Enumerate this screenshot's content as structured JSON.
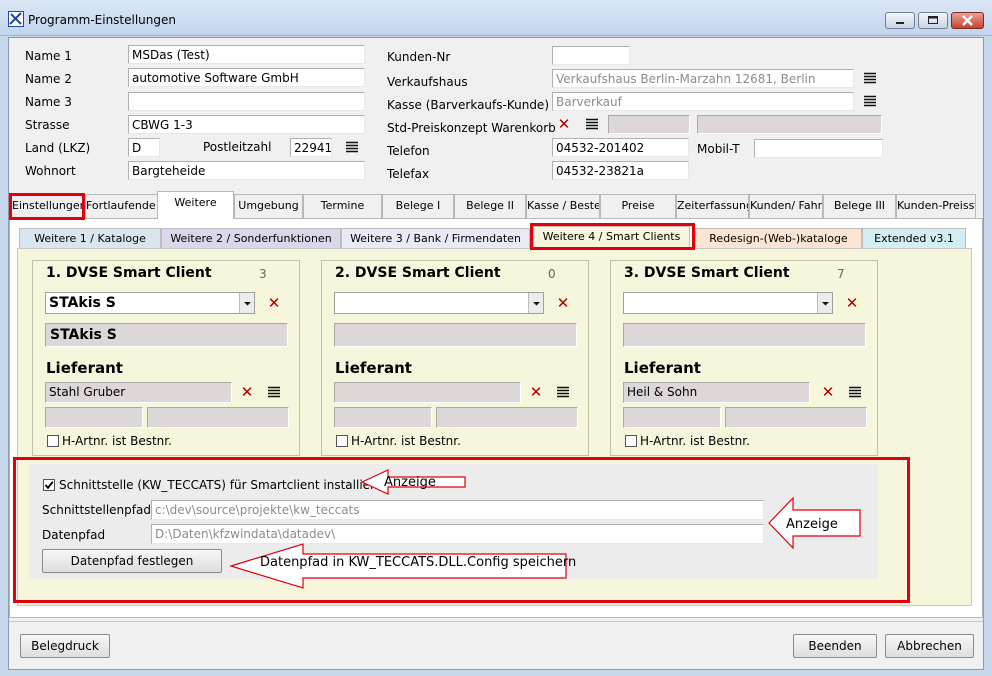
{
  "window": {
    "title": "Programm-Einstellungen"
  },
  "form": {
    "name1": {
      "label": "Name 1",
      "value": "MSDas (Test)"
    },
    "name2": {
      "label": "Name 2",
      "value": "automotive Software GmbH"
    },
    "name3": {
      "label": "Name 3",
      "value": ""
    },
    "strasse": {
      "label": "Strasse",
      "value": "CBWG 1-3"
    },
    "land": {
      "label": "Land (LKZ)",
      "value": "D"
    },
    "plz": {
      "label": "Postleitzahl",
      "value": "22941"
    },
    "wohnort": {
      "label": "Wohnort",
      "value": "Bargteheide"
    },
    "kundennr": {
      "label": "Kunden-Nr",
      "value": ""
    },
    "verkaufshaus": {
      "label": "Verkaufshaus",
      "value": "Verkaufshaus Berlin-Marzahn 12681, Berlin"
    },
    "kasse": {
      "label": "Kasse (Barverkaufs-Kunde)",
      "value": "Barverkauf"
    },
    "preiskonzept": {
      "label": "Std-Preiskonzept Warenkorb",
      "value": ""
    },
    "telefon": {
      "label": "Telefon",
      "value": "04532-201402"
    },
    "mobil": {
      "label": "Mobil-T",
      "value": ""
    },
    "telefax": {
      "label": "Telefax",
      "value": "04532-23821a"
    }
  },
  "tabs": [
    "Einstellungen",
    "Fortlaufende N",
    "Weitere",
    "Umgebung",
    "Termine",
    "Belege I",
    "Belege II",
    "Kasse / Beste",
    "Preise",
    "Zeiterfassung",
    "Kunden/ Fahrz",
    "Belege III",
    "Kunden-Preisst"
  ],
  "subtabs": [
    "Weitere 1 / Kataloge",
    "Weitere 2 / Sonderfunktionen",
    "Weitere 3 / Bank / Firmendaten",
    "Weitere 4 / Smart Clients",
    "Redesign-(Web-)kataloge",
    "Extended v3.1"
  ],
  "cards": [
    {
      "title": "1. DVSE Smart Client",
      "count": "3",
      "dropdown": "STAkis S",
      "name": "STAkis S",
      "lieferant_label": "Lieferant",
      "lieferant": "Stahl Gruber",
      "checkbox_label": "H-Artnr. ist Bestnr."
    },
    {
      "title": "2. DVSE Smart Client",
      "count": "0",
      "dropdown": "",
      "name": "",
      "lieferant_label": "Lieferant",
      "lieferant": "",
      "checkbox_label": "H-Artnr. ist Bestnr."
    },
    {
      "title": "3. DVSE Smart Client",
      "count": "7",
      "dropdown": "",
      "name": "",
      "lieferant_label": "Lieferant",
      "lieferant": "Heil & Sohn",
      "checkbox_label": "H-Artnr. ist Bestnr."
    }
  ],
  "interface": {
    "checkbox_label": "Schnittstelle (KW_TECCATS) für Smartclient installiert",
    "path_label": "Schnittstellenpfad",
    "path_value": "c:\\dev\\source\\projekte\\kw_teccats",
    "data_label": "Datenpfad",
    "data_value": "D:\\Daten\\kfzwindata\\datadev\\",
    "button": "Datenpfad festlegen"
  },
  "annotations": {
    "anzeige1": "Anzeige",
    "anzeige2": "Anzeige",
    "save_note": "Datenpfad in KW_TECCATS.DLL.Config speichern"
  },
  "buttons": {
    "belegdruck": "Belegdruck",
    "beenden": "Beenden",
    "abbrechen": "Abbrechen"
  },
  "colors": {
    "highlight": "#e3000b",
    "panel": "#f6f6dd",
    "delete_icon": "#b00000"
  }
}
